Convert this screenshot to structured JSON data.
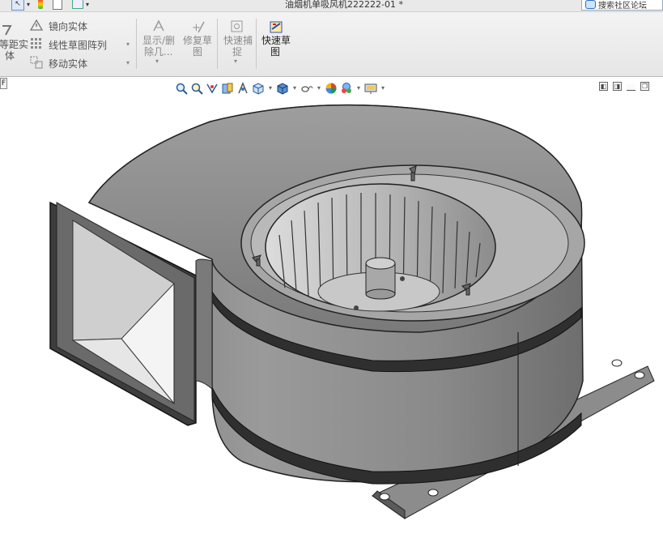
{
  "window": {
    "title": "油烟机单吸风机222222-01 *"
  },
  "search": {
    "label": "搜索社区论坛"
  },
  "ribbon": {
    "offset_entity": {
      "line1": "等距实",
      "line2": "体"
    },
    "mirror_entity": "镜向实体",
    "linear_pattern": "线性草图阵列",
    "move_entity": "移动实体",
    "show_delete": {
      "line1": "显示/删",
      "line2": "除几..."
    },
    "repair_sketch": {
      "line1": "修复草",
      "line2": "图"
    },
    "quick_snaps": {
      "line1": "快速捕",
      "line2": "捉"
    },
    "rapid_sketch": {
      "line1": "快速草",
      "line2": "图"
    }
  },
  "feature_tree_tab": "F",
  "colors": {
    "ribbon_bg": "#ececec",
    "model_gray": "#8a8a8a",
    "model_dark": "#3d3d3d",
    "accent": "#1a5fb4"
  }
}
